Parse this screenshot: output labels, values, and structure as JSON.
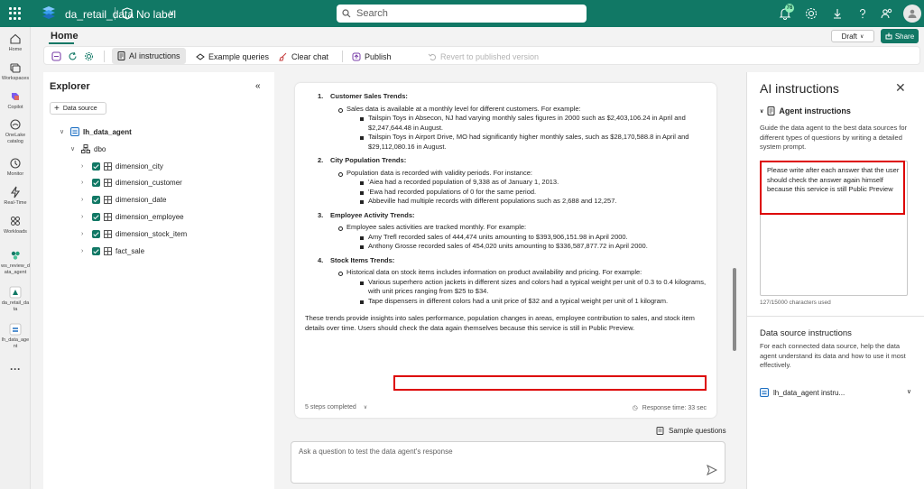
{
  "topbar": {
    "workspace": "da_retail_data",
    "label": "No label",
    "search_placeholder": "Search",
    "notification_count": "76"
  },
  "rail": [
    {
      "key": "home",
      "label": "Home"
    },
    {
      "key": "workspaces",
      "label": "Workspaces"
    },
    {
      "key": "copilot",
      "label": "Copilot"
    },
    {
      "key": "onelake",
      "label": "OneLake catalog"
    },
    {
      "key": "monitor",
      "label": "Monitor"
    },
    {
      "key": "realtime",
      "label": "Real-Time"
    },
    {
      "key": "workloads",
      "label": "Workloads"
    },
    {
      "key": "ws",
      "label": "ws_review_d ata_agent"
    },
    {
      "key": "dard",
      "label": "da_retail_da ta"
    },
    {
      "key": "lhag",
      "label": "lh_data_age nt"
    }
  ],
  "header": {
    "tab": "Home",
    "draft": "Draft",
    "share": "Share"
  },
  "toolbar": {
    "ai": "AI instructions",
    "examples": "Example queries",
    "clear": "Clear chat",
    "publish": "Publish",
    "revert": "Revert to published version"
  },
  "explorer": {
    "title": "Explorer",
    "ds_button": "Data source",
    "lakehouse": "lh_data_agent",
    "schema": "dbo",
    "tables": [
      "dimension_city",
      "dimension_customer",
      "dimension_date",
      "dimension_employee",
      "dimension_stock_item",
      "fact_sale"
    ]
  },
  "chat": {
    "sections": [
      {
        "num": "1.",
        "title": "Customer Sales Trends",
        "colon": ":",
        "intro": "Sales data is available at a monthly level for different customers. For example:",
        "items": [
          "Tailspin Toys in Absecon, NJ had varying monthly sales figures in 2000 such as $2,403,106.24 in April and $2,247,644.48 in August.",
          "Tailspin Toys in Airport Drive, MO had significantly higher monthly sales, such as $28,170,588.8 in April and $29,112,080.16 in August."
        ]
      },
      {
        "num": "2.",
        "title": "City Population Trends",
        "colon": ":",
        "intro": "Population data is recorded with validity periods. For instance:",
        "items": [
          "'Aiea had a recorded population of 9,338 as of January 1, 2013.",
          "'Ewa had recorded populations of 0 for the same period.",
          "Abbeville had multiple records with different populations such as 2,688 and 12,257."
        ]
      },
      {
        "num": "3.",
        "title": "Employee Activity Trends",
        "colon": ":",
        "intro": "Employee sales activities are tracked monthly. For example:",
        "items": [
          "Amy Trefl recorded sales of 444,474 units amounting to $393,906,151.98 in April 2000.",
          "Anthony Grosse recorded sales of 454,020 units amounting to $336,587,877.72 in April 2000."
        ]
      },
      {
        "num": "4.",
        "title": "Stock Items Trends",
        "colon": ":",
        "intro": "Historical data on stock items includes information on product availability and pricing. For example:",
        "items": [
          "Various superhero action jackets in different sizes and colors had a typical weight per unit of 0.3 to 0.4 kilograms, with unit prices ranging from $25 to $34.",
          "Tape dispensers in different colors had a unit price of $32 and a typical weight per unit of 1 kilogram."
        ]
      }
    ],
    "summary": "These trends provide insights into sales performance, population changes in areas, employee contribution to sales, and stock item details over time.",
    "highlight": "Users should check the data again themselves because this service is still in Public Preview.",
    "steps": "5 steps completed",
    "response_time": "Response time: 33 sec",
    "sample_questions": "Sample questions",
    "ask_placeholder": "Ask a question to test the data agent's response"
  },
  "panel": {
    "title": "AI instructions",
    "agent_title": "Agent instructions",
    "agent_desc": "Guide the data agent to the best data sources for different types of questions by writing a detailed system prompt.",
    "prompt": "Please write after each answer that the user should check the answer again himself because this service is still Public Preview",
    "char_count": "127/15000 characters used",
    "ds_title": "Data source instructions",
    "ds_desc": "For each connected data source, help the data agent understand its data and how to use it most effectively.",
    "ds_item": "lh_data_agent instru..."
  },
  "colors": {
    "brand": "#117865",
    "highlight": "#dd0000"
  }
}
